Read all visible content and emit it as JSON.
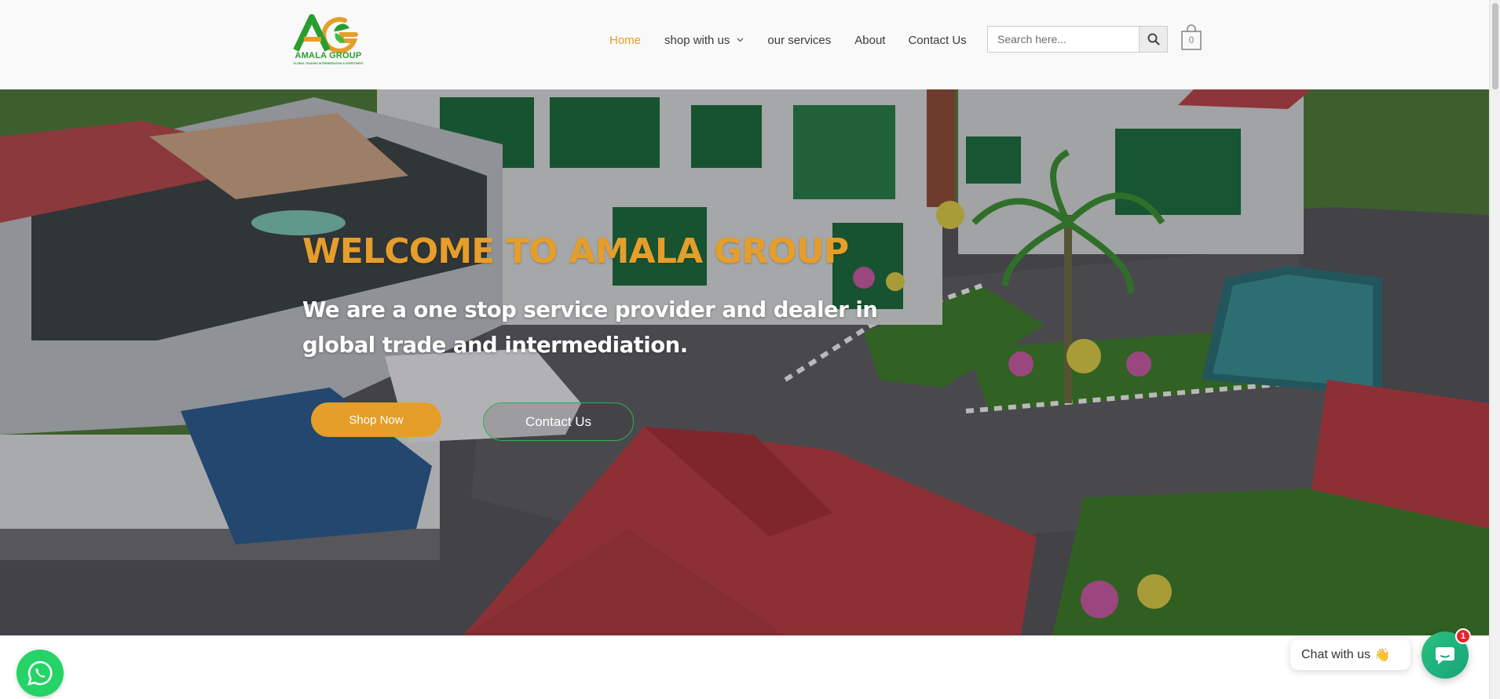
{
  "brand": {
    "name": "AMALA GROUP",
    "tagline": "GLOBAL TRADING INTERMEDIATION & INVESTMENT",
    "colors": {
      "green": "#2a9d2e",
      "orange": "#e59e2a"
    },
    "icon": "ag-leaf-logo"
  },
  "nav": {
    "items": [
      {
        "label": "Home",
        "active": true
      },
      {
        "label": "shop with us",
        "has_dropdown": true,
        "icon": "chevron-down-icon"
      },
      {
        "label": "our services"
      },
      {
        "label": "About"
      },
      {
        "label": "Contact Us"
      }
    ],
    "accent": "#e59e2a"
  },
  "search": {
    "placeholder": "Search here...",
    "icon": "search-icon"
  },
  "cart": {
    "count": "0",
    "icon": "shopping-bag-icon"
  },
  "hero": {
    "title": "WELCOME TO AMALA GROUP",
    "subtitle": "We are a one stop service provider and dealer in global trade and intermediation.",
    "primary_button": "Shop Now",
    "secondary_button": "Contact Us",
    "title_color": "#e59e2a",
    "secondary_border_color": "#2fb34a"
  },
  "widgets": {
    "whatsapp_icon": "whatsapp-icon",
    "chat_prompt": "Chat with us",
    "chat_emoji": "👋",
    "chat_icon": "chat-bubble-icon",
    "chat_badge": "1"
  }
}
